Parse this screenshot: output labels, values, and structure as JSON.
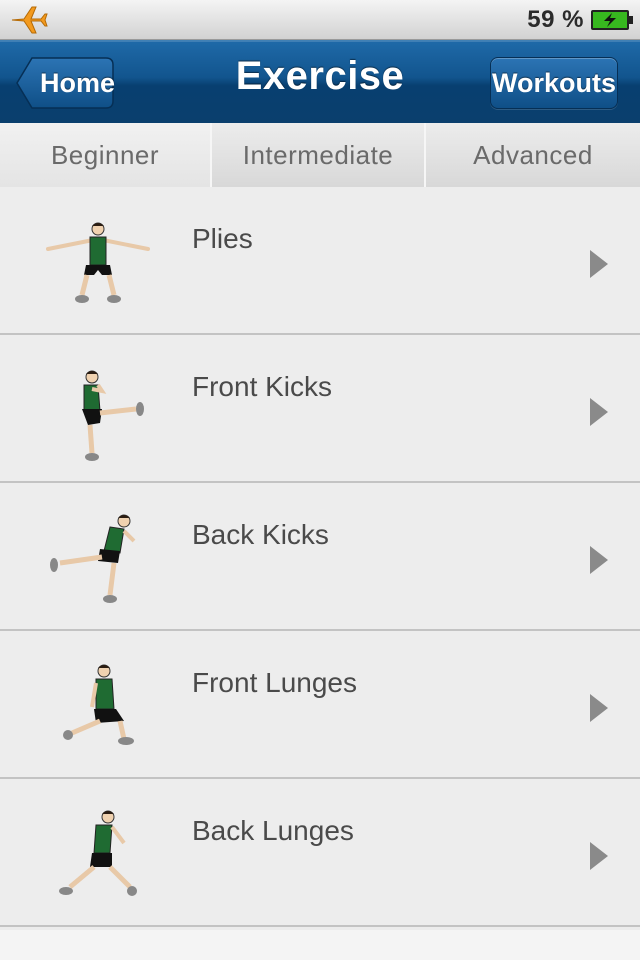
{
  "status_bar": {
    "battery_percent": "59 %",
    "airplane_icon": "airplane-icon",
    "battery_icon": "battery-charging-icon"
  },
  "nav": {
    "title": "Exercise",
    "back_label": "Home",
    "right_label": "Workouts"
  },
  "segments": [
    {
      "label": "Beginner",
      "selected": true
    },
    {
      "label": "Intermediate",
      "selected": false
    },
    {
      "label": "Advanced",
      "selected": false
    }
  ],
  "exercises": [
    {
      "name": "Plies",
      "icon": "plies-figure-icon"
    },
    {
      "name": "Front Kicks",
      "icon": "front-kick-figure-icon"
    },
    {
      "name": "Back Kicks",
      "icon": "back-kick-figure-icon"
    },
    {
      "name": "Front Lunges",
      "icon": "front-lunge-figure-icon"
    },
    {
      "name": "Back Lunges",
      "icon": "back-lunge-figure-icon"
    }
  ],
  "colors": {
    "nav_blue": "#0f4f87",
    "airplane_orange": "#f39a1e",
    "battery_green": "#37b81f",
    "shirt_green": "#1f6b32"
  }
}
